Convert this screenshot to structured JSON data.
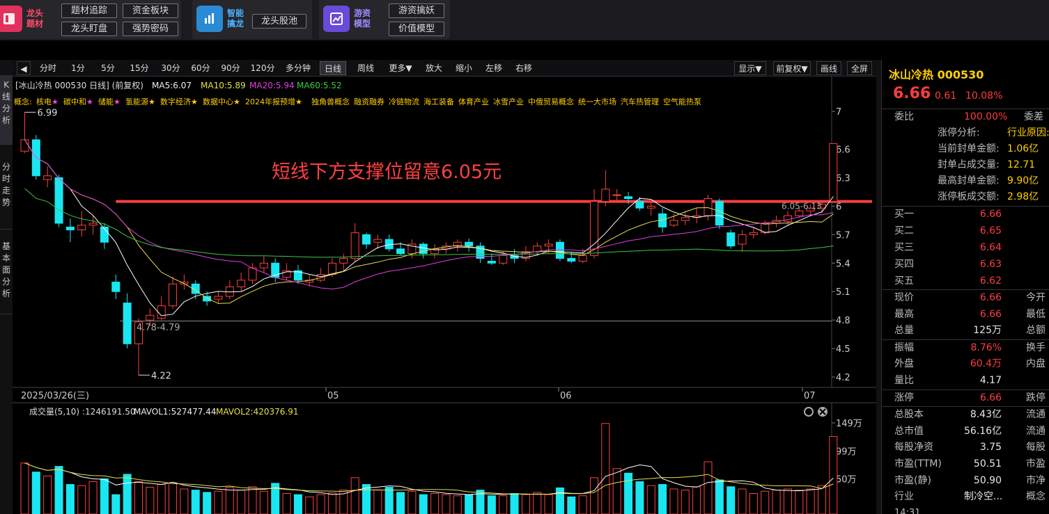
{
  "topbar": {
    "group1": {
      "label1": "龙头",
      "label2": "题材",
      "buttons": [
        "题材追踪",
        "资金板块",
        "龙头盯盘",
        "强势密码"
      ]
    },
    "group2": {
      "label1": "智能",
      "label2": "擒龙",
      "buttons": [
        "龙头股池"
      ]
    },
    "group3": {
      "label1": "游资",
      "label2": "模型",
      "buttons": [
        "游资擒妖",
        "价值模型"
      ]
    }
  },
  "toolbar": {
    "left": [
      "分时",
      "1分",
      "5分",
      "15分",
      "30分",
      "60分",
      "90分",
      "120分",
      "多分钟",
      "日线",
      "周线",
      "更多▼",
      "放大",
      "缩小",
      "左移",
      "右移"
    ],
    "active": "日线",
    "right": [
      "显示▼",
      "前复权▼",
      "画线",
      "全屏"
    ]
  },
  "side_tabs": [
    "K线分析",
    "分时走势",
    "基本面分析"
  ],
  "kchart": {
    "header": "[冰山冷热 000530 日线] (前复权)",
    "ma5": "MA5:6.07",
    "ma10": "MA10:5.89",
    "ma20": "MA20:5.94",
    "ma60": "MA60:5.52",
    "concepts_prefix": "概念:",
    "concepts": [
      "核电★",
      "碳中和★",
      "储能★",
      "氢能源★",
      "数字经济★",
      "数据中心★",
      "2024年报预增★",
      "独角兽概念",
      "融资融券",
      "冷链物流",
      "海工装备",
      "体育产业",
      "冰雪产业",
      "中俄贸易概念",
      "统一大市场",
      "汽车热管理",
      "空气能热泵"
    ],
    "annotation": "短线下方支撑位留意6.05元",
    "label_high": "6.99",
    "label_low": "4.22",
    "label_gap1": "4.78-4.79",
    "label_gap2": "6.05-6.13",
    "x_labels": [
      "2025/03/26(三)",
      "05",
      "06",
      "07"
    ]
  },
  "volume": {
    "title": "成交量(5,10)",
    "vol": ":1246191.50",
    "mavol1": "MAVOL1:527477.44",
    "mavol2": "MAVOL2:420376.91",
    "y_labels": [
      "149万",
      "99万",
      "50万"
    ]
  },
  "panel": {
    "name": "冰山冷热 000530",
    "price": "6.66",
    "change": "0.61",
    "pct": "10.08%",
    "weibi_label": "委比",
    "weibi_value": "100.00%",
    "weicha_label": "委差",
    "analysis": [
      {
        "label": "涨停分析:",
        "value": "行业原因:"
      },
      {
        "label": "当前封单金额:",
        "value": "1.06亿"
      },
      {
        "label": "封单占成交量:",
        "value": "12.71"
      },
      {
        "label": "最高封单金额:",
        "value": "9.90亿"
      },
      {
        "label": "涨停板成交额:",
        "value": "2.98亿"
      }
    ],
    "bids": [
      {
        "label": "买一",
        "price": "6.66"
      },
      {
        "label": "买二",
        "price": "6.65"
      },
      {
        "label": "买三",
        "price": "6.64"
      },
      {
        "label": "买四",
        "price": "6.63"
      },
      {
        "label": "买五",
        "price": "6.62"
      }
    ],
    "stats": [
      {
        "label": "现价",
        "value": "6.66",
        "color": "#ff3d3d",
        "right": "今开"
      },
      {
        "label": "最高",
        "value": "6.66",
        "color": "#ff3d3d",
        "right": "最低"
      },
      {
        "label": "总量",
        "value": "125万",
        "color": "#e8e8e8",
        "right": "总额"
      },
      {
        "label": "振幅",
        "value": "8.76%",
        "color": "#ff3d3d",
        "right": "换手"
      },
      {
        "label": "外盘",
        "value": "60.4万",
        "color": "#ff3d3d",
        "right": "内盘"
      },
      {
        "label": "量比",
        "value": "4.17",
        "color": "#e8e8e8",
        "right": ""
      },
      {
        "label": "涨停",
        "value": "6.66",
        "color": "#ff3d3d",
        "right": "跌停"
      },
      {
        "label": "总股本",
        "value": "8.43亿",
        "color": "#e8e8e8",
        "right": "流通"
      },
      {
        "label": "总市值",
        "value": "56.16亿",
        "color": "#e8e8e8",
        "right": "流通"
      },
      {
        "label": "每股净资",
        "value": "3.75",
        "color": "#e8e8e8",
        "right": "每股"
      },
      {
        "label": "市盈(TTM)",
        "value": "50.51",
        "color": "#e8e8e8",
        "right": "市盈"
      },
      {
        "label": "市盈(静)",
        "value": "50.90",
        "color": "#e8e8e8",
        "right": "市净"
      },
      {
        "label": "行业",
        "value": "制冷空...",
        "color": "#e8e8e8",
        "right": "概念"
      }
    ],
    "time": "14:31"
  },
  "chart_data": {
    "type": "candlestick",
    "y_ticks": [
      7.0,
      6.6,
      6.3,
      6.0,
      5.7,
      5.4,
      5.1,
      4.8,
      4.5,
      4.2
    ],
    "ylim": [
      4.2,
      7.0
    ],
    "support_level": 6.05,
    "candles": [
      [
        6.58,
        6.7,
        6.99,
        6.56,
        78
      ],
      [
        6.7,
        6.32,
        6.75,
        6.28,
        62
      ],
      [
        6.28,
        6.32,
        6.42,
        6.2,
        55
      ],
      [
        6.3,
        5.82,
        6.33,
        5.78,
        72
      ],
      [
        5.78,
        5.75,
        5.87,
        5.62,
        40
      ],
      [
        5.75,
        5.8,
        5.95,
        5.68,
        38
      ],
      [
        5.8,
        5.82,
        5.9,
        5.7,
        45
      ],
      [
        5.78,
        5.62,
        5.82,
        5.55,
        50
      ],
      [
        5.2,
        5.1,
        5.28,
        5.02,
        22
      ],
      [
        4.98,
        4.55,
        5.08,
        4.5,
        58
      ],
      [
        4.55,
        4.78,
        4.82,
        4.22,
        45
      ],
      [
        4.8,
        4.85,
        4.92,
        4.74,
        35
      ],
      [
        4.82,
        4.95,
        5.05,
        4.8,
        40
      ],
      [
        4.95,
        5.18,
        5.26,
        4.92,
        42
      ],
      [
        5.18,
        5.2,
        5.28,
        5.12,
        32
      ],
      [
        5.18,
        5.08,
        5.22,
        5.02,
        30
      ],
      [
        5.05,
        5.0,
        5.1,
        4.95,
        26
      ],
      [
        5.02,
        5.05,
        5.1,
        4.98,
        28
      ],
      [
        5.05,
        5.15,
        5.22,
        5.02,
        35
      ],
      [
        5.15,
        5.22,
        5.3,
        5.1,
        30
      ],
      [
        5.22,
        5.35,
        5.4,
        5.18,
        36
      ],
      [
        5.35,
        5.4,
        5.48,
        5.3,
        28
      ],
      [
        5.4,
        5.25,
        5.45,
        5.2,
        42
      ],
      [
        5.25,
        5.32,
        5.4,
        5.22,
        24
      ],
      [
        5.32,
        5.22,
        5.38,
        5.18,
        22
      ],
      [
        5.2,
        5.22,
        5.28,
        5.15,
        18
      ],
      [
        5.22,
        5.28,
        5.35,
        5.2,
        22
      ],
      [
        5.28,
        5.4,
        5.45,
        5.25,
        25
      ],
      [
        5.4,
        5.45,
        5.5,
        5.32,
        30
      ],
      [
        5.45,
        5.72,
        5.82,
        5.42,
        52
      ],
      [
        5.7,
        5.6,
        5.72,
        5.55,
        40
      ],
      [
        5.62,
        5.65,
        5.7,
        5.55,
        30
      ],
      [
        5.65,
        5.55,
        5.7,
        5.52,
        35
      ],
      [
        5.55,
        5.5,
        5.62,
        5.48,
        26
      ],
      [
        5.5,
        5.6,
        5.65,
        5.45,
        28
      ],
      [
        5.6,
        5.5,
        5.62,
        5.45,
        22
      ],
      [
        5.5,
        5.55,
        5.6,
        5.45,
        24
      ],
      [
        5.55,
        5.58,
        5.62,
        5.5,
        22
      ],
      [
        5.58,
        5.62,
        5.65,
        5.52,
        20
      ],
      [
        5.62,
        5.58,
        5.66,
        5.52,
        22
      ],
      [
        5.58,
        5.45,
        5.62,
        5.4,
        30
      ],
      [
        5.42,
        5.4,
        5.5,
        5.38,
        20
      ],
      [
        5.4,
        5.48,
        5.52,
        5.38,
        20
      ],
      [
        5.48,
        5.45,
        5.55,
        5.4,
        24
      ],
      [
        5.45,
        5.52,
        5.58,
        5.42,
        22
      ],
      [
        5.52,
        5.58,
        5.62,
        5.48,
        26
      ],
      [
        5.58,
        5.6,
        5.65,
        5.5,
        22
      ],
      [
        5.62,
        5.45,
        5.65,
        5.42,
        34
      ],
      [
        5.45,
        5.42,
        5.52,
        5.4,
        18
      ],
      [
        5.42,
        5.48,
        5.55,
        5.4,
        20
      ],
      [
        5.48,
        6.05,
        6.18,
        5.45,
        52
      ],
      [
        6.05,
        6.18,
        6.38,
        6.0,
        148
      ],
      [
        6.12,
        6.12,
        6.18,
        6.05,
        68
      ],
      [
        6.1,
        6.08,
        6.15,
        6.02,
        60
      ],
      [
        6.05,
        5.98,
        6.1,
        5.95,
        45
      ],
      [
        5.98,
        6.0,
        6.05,
        5.9,
        38
      ],
      [
        5.92,
        5.78,
        5.98,
        5.72,
        40
      ],
      [
        5.8,
        5.85,
        5.92,
        5.78,
        32
      ],
      [
        5.85,
        5.88,
        5.95,
        5.8,
        30
      ],
      [
        5.88,
        5.9,
        5.98,
        5.82,
        36
      ],
      [
        5.9,
        6.08,
        6.12,
        5.85,
        80
      ],
      [
        6.05,
        5.8,
        6.08,
        5.76,
        48
      ],
      [
        5.72,
        5.58,
        5.75,
        5.55,
        36
      ],
      [
        5.6,
        5.7,
        5.75,
        5.52,
        32
      ],
      [
        5.7,
        5.72,
        5.78,
        5.66,
        24
      ],
      [
        5.72,
        5.82,
        5.85,
        5.7,
        28
      ],
      [
        5.82,
        5.85,
        5.9,
        5.78,
        30
      ],
      [
        5.84,
        5.9,
        5.95,
        5.8,
        32
      ],
      [
        5.9,
        5.95,
        6.0,
        5.88,
        30
      ],
      [
        5.95,
        5.98,
        6.02,
        5.9,
        32
      ],
      [
        5.98,
        6.02,
        6.05,
        5.93,
        38
      ],
      [
        6.05,
        6.66,
        6.66,
        6.05,
        125
      ]
    ],
    "ma_lines": {
      "MA5": {
        "color": "#ffffff"
      },
      "MA10": {
        "color": "#e8e04a"
      },
      "MA20": {
        "color": "#e040e0"
      },
      "MA60": {
        "color": "#3ec83e"
      }
    },
    "volume_ylim": [
      0,
      149
    ],
    "volume_unit": "万"
  }
}
